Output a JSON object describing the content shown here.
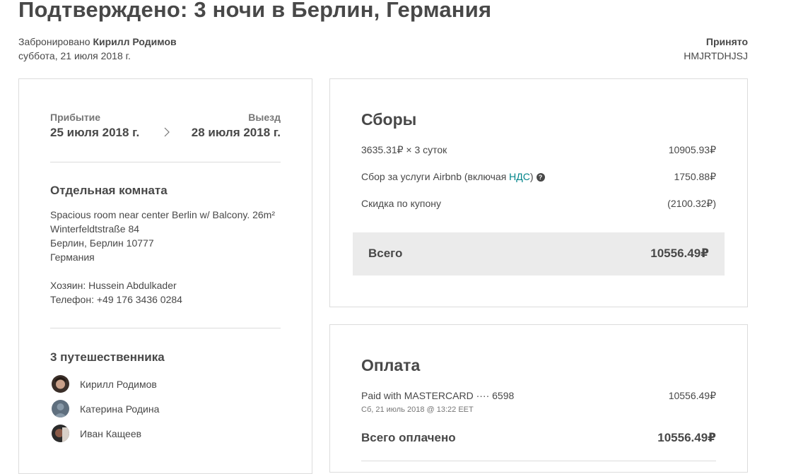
{
  "header": {
    "title": "Подтверждено: 3 ночи в Берлин, Германия",
    "booked_by_label": "Забронировано",
    "booked_by_name": "Кирилл Родимов",
    "booked_date": "суббота, 21 июля 2018 г.",
    "status": "Принято",
    "confirmation_code": "HMJRTDHJSJ"
  },
  "trip": {
    "checkin_label": "Прибытие",
    "checkin_date": "25 июля 2018 г.",
    "checkout_label": "Выезд",
    "checkout_date": "28 июля 2018 г.",
    "room_type": "Отдельная комната",
    "listing_name": "Spacious room near center Berlin w/ Balcony. 26m²",
    "address_street": "Winterfeldtstraße 84",
    "address_city": "Берлин, Берлин 10777",
    "address_country": "Германия",
    "host": "Хозяин: Hussein Abdulkader",
    "phone": "Телефон: +49 176 3436 0284",
    "guests_title": "3 путешественника",
    "guests": [
      {
        "name": "Кирилл Родимов"
      },
      {
        "name": "Катерина Родина"
      },
      {
        "name": "Иван Кащеев"
      }
    ]
  },
  "fees": {
    "title": "Сборы",
    "nightly_label": "3635.31₽ × 3 суток",
    "nightly_value": "10905.93₽",
    "service_label_prefix": "Сбор за услуги Airbnb (включая ",
    "service_label_link": "НДС",
    "service_label_suffix": ")",
    "service_help": "?",
    "service_value": "1750.88₽",
    "coupon_label": "Скидка по купону",
    "coupon_value": "(2100.32₽)",
    "total_label": "Всего",
    "total_value": "10556.49₽"
  },
  "payment": {
    "title": "Оплата",
    "method_label": "Paid with MASTERCARD ···· 6598",
    "method_value": "10556.49₽",
    "method_date": "Сб, 21 июль 2018 @ 13:22 EET",
    "paid_total_label": "Всего оплачено",
    "paid_total_value": "10556.49₽"
  },
  "colors": {
    "text": "#484848",
    "muted": "#767676",
    "link": "#008489",
    "border": "#dcdcdc",
    "total_bg": "#ebebeb"
  }
}
